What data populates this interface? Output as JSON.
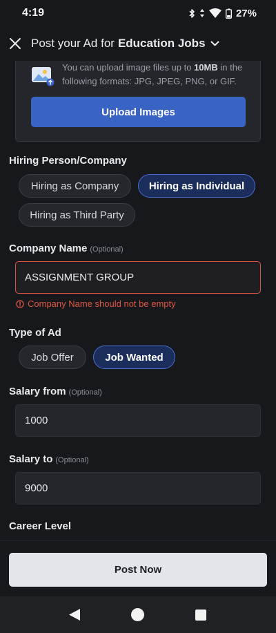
{
  "status_bar": {
    "time": "4:19",
    "battery": "27%",
    "icons": [
      "bluetooth-icon",
      "data-arrows-icon",
      "wifi-icon",
      "battery-icon"
    ]
  },
  "header": {
    "prefix": "Post your Ad for",
    "category": "Education Jobs",
    "icons": [
      "close-icon",
      "chevron-down-icon"
    ]
  },
  "upload": {
    "text_before": "You can upload image files up to",
    "size_limit": "10MB",
    "text_after": "in the following formats: JPG, JPEG, PNG, or GIF.",
    "button_label": "Upload Images",
    "icon": "image-upload-icon"
  },
  "hiring": {
    "label": "Hiring Person/Company",
    "options": [
      "Hiring as Company",
      "Hiring as Individual",
      "Hiring as Third Party"
    ],
    "selected": "Hiring as Individual"
  },
  "company_name": {
    "label": "Company Name",
    "optional": "(Optional)",
    "value": "ASSIGNMENT GROUP",
    "error": "Company Name should not be empty"
  },
  "type_of_ad": {
    "label": "Type of Ad",
    "options": [
      "Job Offer",
      "Job Wanted"
    ],
    "selected": "Job Wanted"
  },
  "salary_from": {
    "label": "Salary from",
    "optional": "(Optional)",
    "value": "1000"
  },
  "salary_to": {
    "label": "Salary to",
    "optional": "(Optional)",
    "value": "9000"
  },
  "career_level": {
    "label": "Career Level"
  },
  "footer": {
    "post_label": "Post Now"
  },
  "colors": {
    "background": "#17181c",
    "accent": "#3a63c6",
    "error": "#e0563f"
  }
}
